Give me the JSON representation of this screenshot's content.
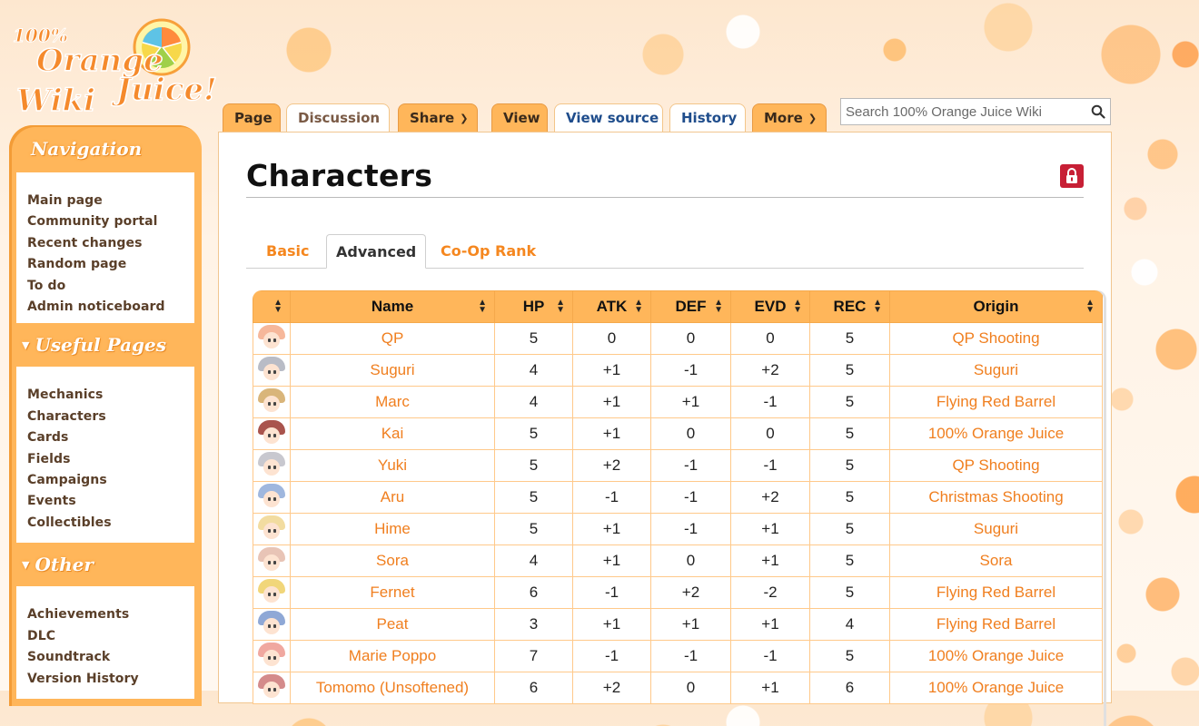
{
  "logo": {
    "line1": "100%",
    "line2": "Orange",
    "line3": "Wiki",
    "line4": "Juice!"
  },
  "tabs": {
    "page": "Page",
    "discussion": "Discussion",
    "share": "Share",
    "view": "View",
    "view_source": "View source",
    "history": "History",
    "more": "More"
  },
  "search": {
    "placeholder": "Search 100% Orange Juice Wiki"
  },
  "sidebar": {
    "navigation": {
      "heading": "Navigation",
      "items": [
        "Main page",
        "Community portal",
        "Recent changes",
        "Random page",
        "To do",
        "Admin noticeboard"
      ]
    },
    "useful": {
      "heading": "Useful Pages",
      "items": [
        "Mechanics",
        "Characters",
        "Cards",
        "Fields",
        "Campaigns",
        "Events",
        "Collectibles"
      ]
    },
    "other": {
      "heading": "Other",
      "items": [
        "Achievements",
        "DLC",
        "Soundtrack",
        "Version History"
      ]
    }
  },
  "page": {
    "title": "Characters",
    "subtabs": [
      "Basic",
      "Advanced",
      "Co-Op Rank"
    ]
  },
  "table": {
    "headers": [
      "",
      "Name",
      "HP",
      "ATK",
      "DEF",
      "EVD",
      "REC",
      "Origin"
    ],
    "rows": [
      {
        "name": "QP",
        "hp": "5",
        "atk": "0",
        "def": "0",
        "evd": "0",
        "rec": "5",
        "origin": "QP Shooting",
        "hair": "#f6b79a"
      },
      {
        "name": "Suguri",
        "hp": "4",
        "atk": "+1",
        "def": "-1",
        "evd": "+2",
        "rec": "5",
        "origin": "Suguri",
        "hair": "#b9bcc6"
      },
      {
        "name": "Marc",
        "hp": "4",
        "atk": "+1",
        "def": "+1",
        "evd": "-1",
        "rec": "5",
        "origin": "Flying Red Barrel",
        "hair": "#d9b57a"
      },
      {
        "name": "Kai",
        "hp": "5",
        "atk": "+1",
        "def": "0",
        "evd": "0",
        "rec": "5",
        "origin": "100% Orange Juice",
        "hair": "#a9544d"
      },
      {
        "name": "Yuki",
        "hp": "5",
        "atk": "+2",
        "def": "-1",
        "evd": "-1",
        "rec": "5",
        "origin": "QP Shooting",
        "hair": "#c8c8cf"
      },
      {
        "name": "Aru",
        "hp": "5",
        "atk": "-1",
        "def": "-1",
        "evd": "+2",
        "rec": "5",
        "origin": "Christmas Shooting",
        "hair": "#9fb7de"
      },
      {
        "name": "Hime",
        "hp": "5",
        "atk": "+1",
        "def": "-1",
        "evd": "+1",
        "rec": "5",
        "origin": "Suguri",
        "hair": "#f2dca0"
      },
      {
        "name": "Sora",
        "hp": "4",
        "atk": "+1",
        "def": "0",
        "evd": "+1",
        "rec": "5",
        "origin": "Sora",
        "hair": "#e8c4b6"
      },
      {
        "name": "Fernet",
        "hp": "6",
        "atk": "-1",
        "def": "+2",
        "evd": "-2",
        "rec": "5",
        "origin": "Flying Red Barrel",
        "hair": "#f1d67a"
      },
      {
        "name": "Peat",
        "hp": "3",
        "atk": "+1",
        "def": "+1",
        "evd": "+1",
        "rec": "4",
        "origin": "Flying Red Barrel",
        "hair": "#8fa8d6"
      },
      {
        "name": "Marie Poppo",
        "hp": "7",
        "atk": "-1",
        "def": "-1",
        "evd": "-1",
        "rec": "5",
        "origin": "100% Orange Juice",
        "hair": "#f0a8a0"
      },
      {
        "name": "Tomomo (Unsoftened)",
        "hp": "6",
        "atk": "+2",
        "def": "0",
        "evd": "+1",
        "rec": "6",
        "origin": "100% Orange Juice",
        "hair": "#d48b8b"
      }
    ]
  },
  "colors": {
    "accent": "#ffb65a",
    "link": "#f07f1f",
    "lock": "#c71f35"
  }
}
